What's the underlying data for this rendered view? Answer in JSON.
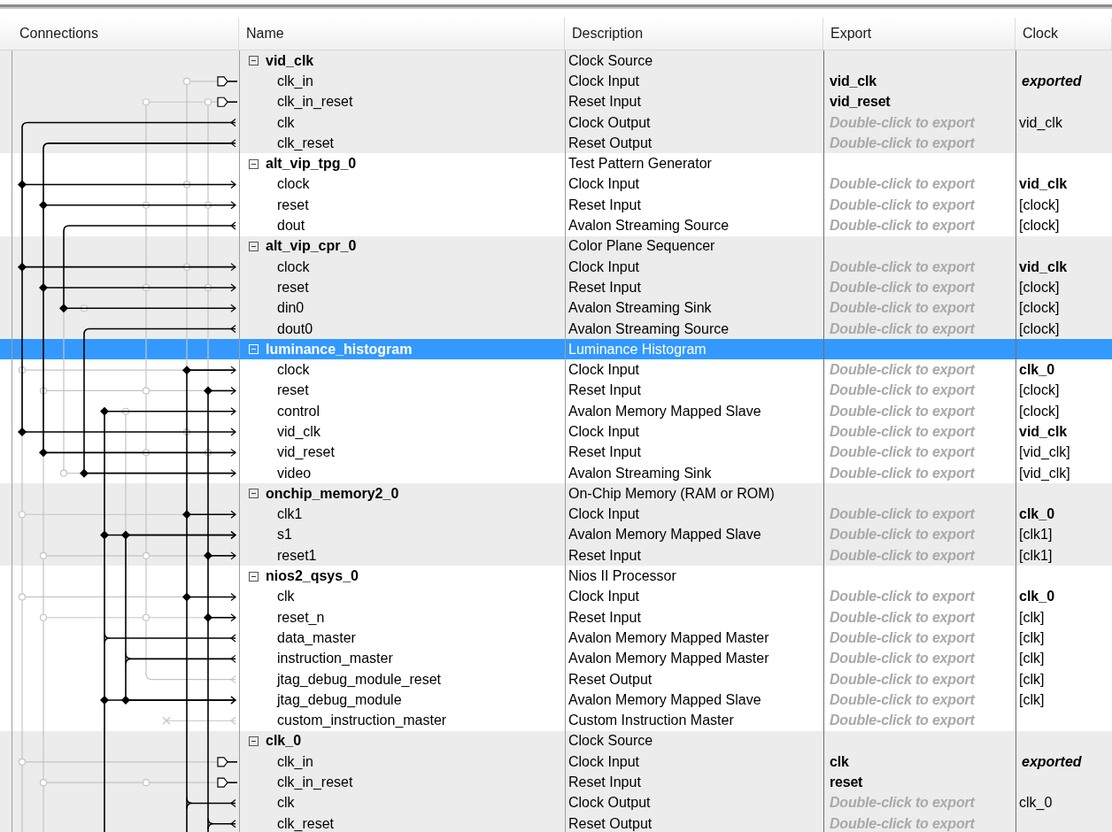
{
  "columns": [
    "Connections",
    "Name",
    "Description",
    "Export",
    "Clock"
  ],
  "components": [
    {
      "name": "vid_clk",
      "description": "Clock Source",
      "expanded": true,
      "selected": false,
      "ports": [
        {
          "name": "clk_in",
          "description": "Clock Input",
          "export": {
            "text": "vid_clk",
            "kind": "name"
          },
          "clock": {
            "text": "exported",
            "kind": "bold-italic"
          }
        },
        {
          "name": "clk_in_reset",
          "description": "Reset Input",
          "export": {
            "text": "vid_reset",
            "kind": "name"
          }
        },
        {
          "name": "clk",
          "description": "Clock Output",
          "export": {
            "text": "Double-click to export",
            "kind": "hint"
          },
          "clock": {
            "text": "vid_clk",
            "kind": "plain"
          }
        },
        {
          "name": "clk_reset",
          "description": "Reset Output",
          "export": {
            "text": "Double-click to export",
            "kind": "hint"
          }
        }
      ]
    },
    {
      "name": "alt_vip_tpg_0",
      "description": "Test Pattern Generator",
      "expanded": true,
      "selected": false,
      "ports": [
        {
          "name": "clock",
          "description": "Clock Input",
          "export": {
            "text": "Double-click to export",
            "kind": "hint"
          },
          "clock": {
            "text": "vid_clk",
            "kind": "bold"
          }
        },
        {
          "name": "reset",
          "description": "Reset Input",
          "export": {
            "text": "Double-click to export",
            "kind": "hint"
          },
          "clock": {
            "text": "[clock]",
            "kind": "plain"
          }
        },
        {
          "name": "dout",
          "description": "Avalon Streaming Source",
          "export": {
            "text": "Double-click to export",
            "kind": "hint"
          },
          "clock": {
            "text": "[clock]",
            "kind": "plain"
          }
        }
      ]
    },
    {
      "name": "alt_vip_cpr_0",
      "description": "Color Plane Sequencer",
      "expanded": true,
      "selected": false,
      "ports": [
        {
          "name": "clock",
          "description": "Clock Input",
          "export": {
            "text": "Double-click to export",
            "kind": "hint"
          },
          "clock": {
            "text": "vid_clk",
            "kind": "bold"
          }
        },
        {
          "name": "reset",
          "description": "Reset Input",
          "export": {
            "text": "Double-click to export",
            "kind": "hint"
          },
          "clock": {
            "text": "[clock]",
            "kind": "plain"
          }
        },
        {
          "name": "din0",
          "description": "Avalon Streaming Sink",
          "export": {
            "text": "Double-click to export",
            "kind": "hint"
          },
          "clock": {
            "text": "[clock]",
            "kind": "plain"
          }
        },
        {
          "name": "dout0",
          "description": "Avalon Streaming Source",
          "export": {
            "text": "Double-click to export",
            "kind": "hint"
          },
          "clock": {
            "text": "[clock]",
            "kind": "plain"
          }
        }
      ]
    },
    {
      "name": "luminance_histogram",
      "description": "Luminance Histogram",
      "expanded": true,
      "selected": true,
      "ports": [
        {
          "name": "clock",
          "description": "Clock Input",
          "export": {
            "text": "Double-click to export",
            "kind": "hint"
          },
          "clock": {
            "text": "clk_0",
            "kind": "bold"
          }
        },
        {
          "name": "reset",
          "description": "Reset Input",
          "export": {
            "text": "Double-click to export",
            "kind": "hint"
          },
          "clock": {
            "text": "[clock]",
            "kind": "plain"
          }
        },
        {
          "name": "control",
          "description": "Avalon Memory Mapped Slave",
          "export": {
            "text": "Double-click to export",
            "kind": "hint"
          },
          "clock": {
            "text": "[clock]",
            "kind": "plain"
          }
        },
        {
          "name": "vid_clk",
          "description": "Clock Input",
          "export": {
            "text": "Double-click to export",
            "kind": "hint"
          },
          "clock": {
            "text": "vid_clk",
            "kind": "bold"
          }
        },
        {
          "name": "vid_reset",
          "description": "Reset Input",
          "export": {
            "text": "Double-click to export",
            "kind": "hint"
          },
          "clock": {
            "text": "[vid_clk]",
            "kind": "plain"
          }
        },
        {
          "name": "video",
          "description": "Avalon Streaming Sink",
          "export": {
            "text": "Double-click to export",
            "kind": "hint"
          },
          "clock": {
            "text": "[vid_clk]",
            "kind": "plain"
          }
        }
      ]
    },
    {
      "name": "onchip_memory2_0",
      "description": "On-Chip Memory (RAM or ROM)",
      "expanded": true,
      "selected": false,
      "ports": [
        {
          "name": "clk1",
          "description": "Clock Input",
          "export": {
            "text": "Double-click to export",
            "kind": "hint"
          },
          "clock": {
            "text": "clk_0",
            "kind": "bold"
          }
        },
        {
          "name": "s1",
          "description": "Avalon Memory Mapped Slave",
          "export": {
            "text": "Double-click to export",
            "kind": "hint"
          },
          "clock": {
            "text": "[clk1]",
            "kind": "plain"
          }
        },
        {
          "name": "reset1",
          "description": "Reset Input",
          "export": {
            "text": "Double-click to export",
            "kind": "hint"
          },
          "clock": {
            "text": "[clk1]",
            "kind": "plain"
          }
        }
      ]
    },
    {
      "name": "nios2_qsys_0",
      "description": "Nios II Processor",
      "expanded": true,
      "selected": false,
      "ports": [
        {
          "name": "clk",
          "description": "Clock Input",
          "export": {
            "text": "Double-click to export",
            "kind": "hint"
          },
          "clock": {
            "text": "clk_0",
            "kind": "bold"
          }
        },
        {
          "name": "reset_n",
          "description": "Reset Input",
          "export": {
            "text": "Double-click to export",
            "kind": "hint"
          },
          "clock": {
            "text": "[clk]",
            "kind": "plain"
          }
        },
        {
          "name": "data_master",
          "description": "Avalon Memory Mapped Master",
          "export": {
            "text": "Double-click to export",
            "kind": "hint"
          },
          "clock": {
            "text": "[clk]",
            "kind": "plain"
          }
        },
        {
          "name": "instruction_master",
          "description": "Avalon Memory Mapped Master",
          "export": {
            "text": "Double-click to export",
            "kind": "hint"
          },
          "clock": {
            "text": "[clk]",
            "kind": "plain"
          }
        },
        {
          "name": "jtag_debug_module_reset",
          "description": "Reset Output",
          "export": {
            "text": "Double-click to export",
            "kind": "hint"
          },
          "clock": {
            "text": "[clk]",
            "kind": "plain"
          }
        },
        {
          "name": "jtag_debug_module",
          "description": "Avalon Memory Mapped Slave",
          "export": {
            "text": "Double-click to export",
            "kind": "hint"
          },
          "clock": {
            "text": "[clk]",
            "kind": "plain"
          }
        },
        {
          "name": "custom_instruction_master",
          "description": "Custom Instruction Master",
          "export": {
            "text": "Double-click to export",
            "kind": "hint"
          }
        }
      ]
    },
    {
      "name": "clk_0",
      "description": "Clock Source",
      "expanded": true,
      "selected": false,
      "ports": [
        {
          "name": "clk_in",
          "description": "Clock Input",
          "export": {
            "text": "clk",
            "kind": "name"
          },
          "clock": {
            "text": "exported",
            "kind": "bold-italic"
          }
        },
        {
          "name": "clk_in_reset",
          "description": "Reset Input",
          "export": {
            "text": "reset",
            "kind": "name"
          }
        },
        {
          "name": "clk",
          "description": "Clock Output",
          "export": {
            "text": "Double-click to export",
            "kind": "hint"
          },
          "clock": {
            "text": "clk_0",
            "kind": "plain"
          }
        },
        {
          "name": "clk_reset",
          "description": "Reset Output",
          "export": {
            "text": "Double-click to export",
            "kind": "hint"
          }
        }
      ]
    }
  ]
}
